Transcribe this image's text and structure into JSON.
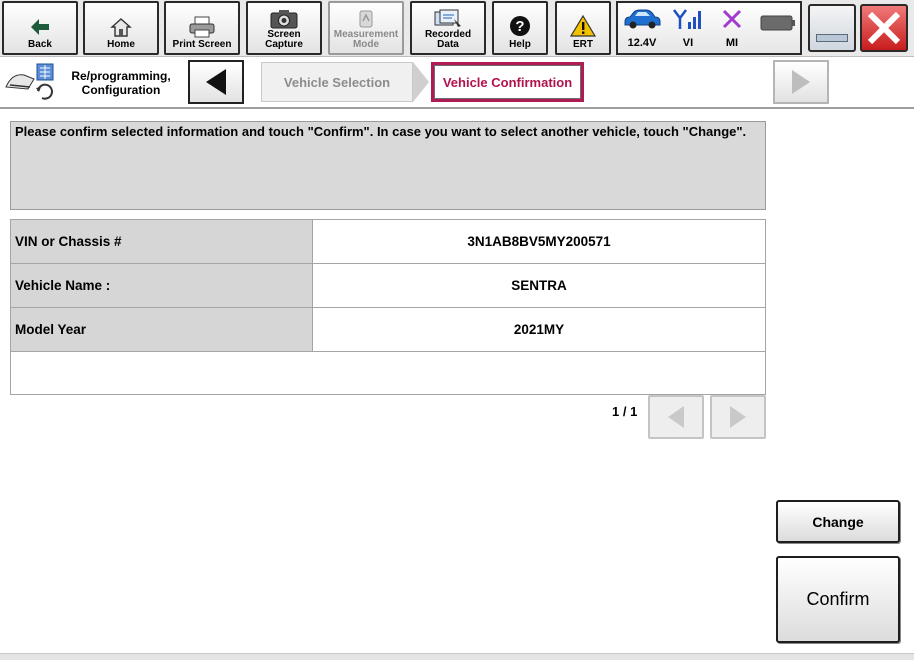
{
  "toolbar": {
    "back": "Back",
    "home": "Home",
    "print_screen": "Print Screen",
    "screen_capture_1": "Screen",
    "screen_capture_2": "Capture",
    "measurement_1": "Measurement",
    "measurement_2": "Mode",
    "recorded_1": "Recorded",
    "recorded_2": "Data",
    "help": "Help",
    "ert": "ERT"
  },
  "status": {
    "battery_voltage": "12.4V",
    "vi": "VI",
    "mi": "MI"
  },
  "breadcrumb": {
    "section_line1": "Re/programming,",
    "section_line2": "Configuration",
    "step1": "Vehicle Selection",
    "step2": "Vehicle Confirmation"
  },
  "message": "Please confirm selected information and touch \"Confirm\". In case you want to select another vehicle, touch \"Change\".",
  "vehicle_info": [
    {
      "label": "VIN or Chassis #",
      "value": "3N1AB8BV5MY200571"
    },
    {
      "label": "Vehicle Name :",
      "value": "SENTRA"
    },
    {
      "label": "Model Year",
      "value": "2021MY"
    }
  ],
  "pager": {
    "text": "1 / 1"
  },
  "actions": {
    "change": "Change",
    "confirm": "Confirm"
  },
  "colors": {
    "accent": "#b0124e",
    "ert_yellow": "#f2c200",
    "car_blue": "#1f6fd0",
    "mi_purple": "#a23ad0"
  }
}
